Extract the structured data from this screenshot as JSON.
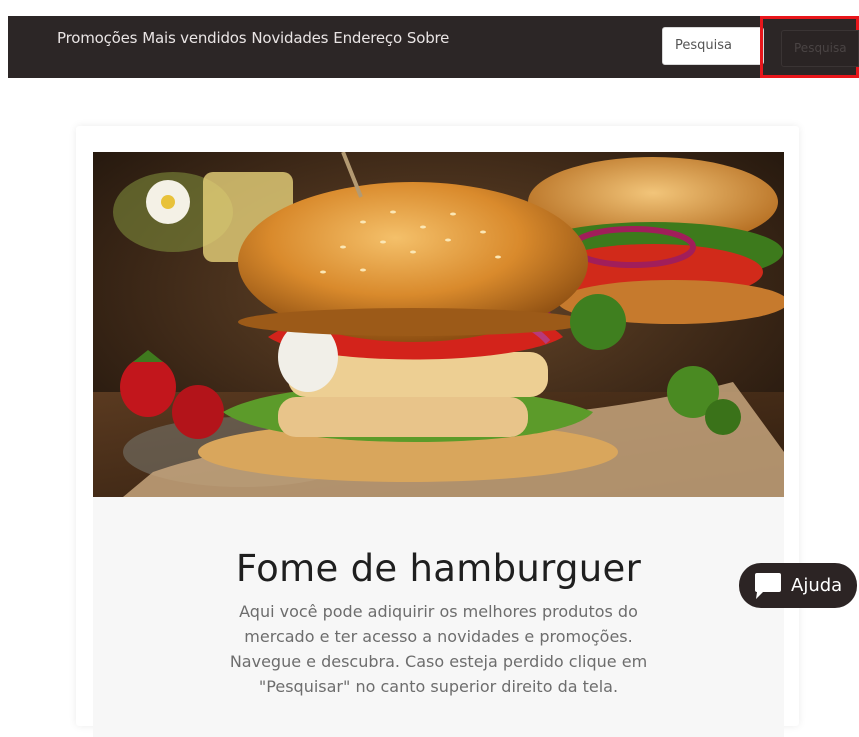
{
  "nav": {
    "links": [
      "Promoções",
      "Mais vendidos",
      "Novidades",
      "Endereço",
      "Sobre"
    ],
    "search_placeholder": "Pesquisa",
    "search_button_label": "Pesquisa"
  },
  "hero": {
    "image_icon": "hamburger-photo"
  },
  "card": {
    "title": "Fome de hamburguer",
    "text": "Aqui você pode adiquirir os melhores produtos do mercado e ter acesso a novidades e promoções. Navegue e descubra. Caso esteja perdido clique em \"Pesquisar\" no canto superior direito da tela."
  },
  "help": {
    "label": "Ajuda",
    "icon": "chat-bubble-icon"
  },
  "colors": {
    "navbar": "#2c2626",
    "highlight_border": "#e8161b",
    "help_button": "#2c2424"
  }
}
